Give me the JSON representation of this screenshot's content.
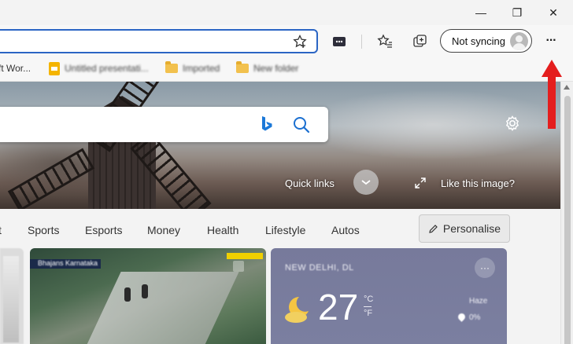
{
  "window": {
    "minimize_glyph": "—",
    "restore_glyph": "❐",
    "close_glyph": "✕"
  },
  "toolbar": {
    "sync_label": "Not syncing",
    "more_glyph": "···"
  },
  "favorites": {
    "items": [
      {
        "label": "ft Wor...",
        "icon": "none"
      },
      {
        "label": "Untitled presentati...",
        "icon": "slides-icon"
      },
      {
        "label": "Imported",
        "icon": "folder-icon"
      },
      {
        "label": "New folder",
        "icon": "folder-icon"
      }
    ]
  },
  "hero": {
    "quick_links": "Quick links",
    "like_image": "Like this image?"
  },
  "nav": {
    "items": [
      "t",
      "Sports",
      "Esports",
      "Money",
      "Health",
      "Lifestyle",
      "Autos"
    ],
    "personalise": "Personalise"
  },
  "news_card": {
    "badge": "Bhajans Karnataka"
  },
  "weather": {
    "city": "NEW DELHI, DL",
    "temperature": "27",
    "unit_c": "°C",
    "unit_f": "°F",
    "condition": "Haze",
    "precip": "0%",
    "more_glyph": "···"
  },
  "colors": {
    "address_focus": "#2b65c4",
    "annotation_arrow": "#e41e1e",
    "weather_card": "#777a9b"
  }
}
